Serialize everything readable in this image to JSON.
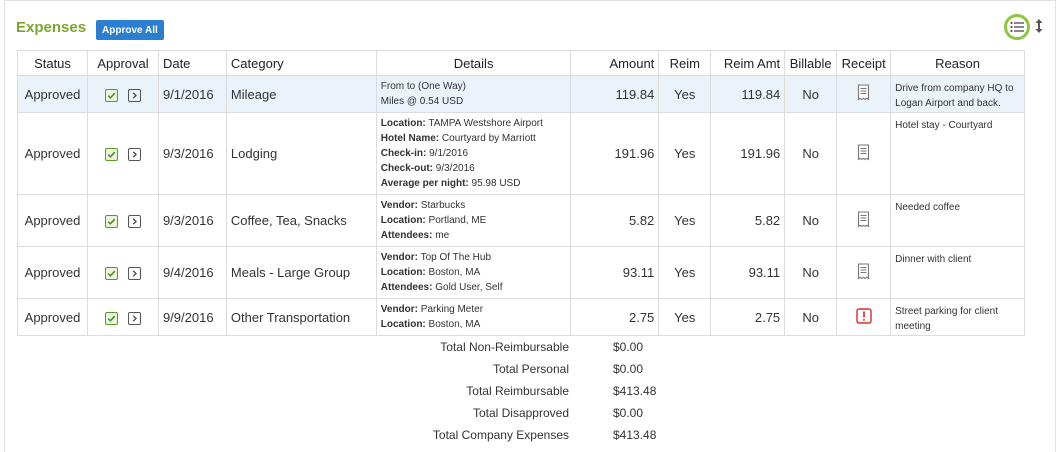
{
  "section": {
    "title": "Expenses",
    "approve_all_label": "Approve All"
  },
  "icons": {
    "view_toggle": "list-icon",
    "sort": "sort-icon",
    "approve": "check-icon",
    "details": "arrow-right-icon",
    "receipt": "receipt-icon",
    "receipt_missing": "exclamation-icon"
  },
  "colors": {
    "accent": "#7aa72c",
    "button": "#2b7fd1",
    "highlight_row": "#eaf2fa",
    "missing_receipt": "#d62c2c",
    "focus_ring": "#8cc63f"
  },
  "table": {
    "headers": [
      "Status",
      "Approval",
      "Date",
      "Category",
      "Details",
      "Amount",
      "Reim",
      "Reim Amt",
      "Billable",
      "Receipt",
      "Reason"
    ],
    "rows": [
      {
        "status": "Approved",
        "date": "9/1/2016",
        "category": "Mileage",
        "details": [
          [
            "",
            "From to (One Way)"
          ],
          [
            "",
            "Miles @ 0.54 USD"
          ]
        ],
        "amount": "119.84",
        "reim": "Yes",
        "reim_amt": "119.84",
        "billable": "No",
        "receipt": "receipt-icon",
        "reason": "Drive from company HQ to Logan Airport and back."
      },
      {
        "status": "Approved",
        "date": "9/3/2016",
        "category": "Lodging",
        "details": [
          [
            "Location:",
            "TAMPA Westshore Airport"
          ],
          [
            "Hotel Name:",
            "Courtyard by Marriott"
          ],
          [
            "Check-in:",
            "9/1/2016"
          ],
          [
            "Check-out:",
            "9/3/2016"
          ],
          [
            "Average per night:",
            "95.98 USD"
          ]
        ],
        "amount": "191.96",
        "reim": "Yes",
        "reim_amt": "191.96",
        "billable": "No",
        "receipt": "receipt-icon",
        "reason": "Hotel stay - Courtyard"
      },
      {
        "status": "Approved",
        "date": "9/3/2016",
        "category": "Coffee, Tea, Snacks",
        "details": [
          [
            "Vendor:",
            "Starbucks"
          ],
          [
            "Location:",
            "Portland, ME"
          ],
          [
            "Attendees:",
            "me"
          ]
        ],
        "amount": "5.82",
        "reim": "Yes",
        "reim_amt": "5.82",
        "billable": "No",
        "receipt": "receipt-icon",
        "reason": "Needed coffee"
      },
      {
        "status": "Approved",
        "date": "9/4/2016",
        "category": "Meals - Large Group",
        "details": [
          [
            "Vendor:",
            "Top Of The Hub"
          ],
          [
            "Location:",
            "Boston, MA"
          ],
          [
            "Attendees:",
            "Gold User, Self"
          ]
        ],
        "amount": "93.11",
        "reim": "Yes",
        "reim_amt": "93.11",
        "billable": "No",
        "receipt": "receipt-icon",
        "reason": "Dinner with client"
      },
      {
        "status": "Approved",
        "date": "9/9/2016",
        "category": "Other Transportation",
        "details": [
          [
            "Vendor:",
            "Parking Meter"
          ],
          [
            "Location:",
            "Boston, MA"
          ]
        ],
        "amount": "2.75",
        "reim": "Yes",
        "reim_amt": "2.75",
        "billable": "No",
        "receipt": "exclamation-icon",
        "reason": "Street parking for client meeting"
      }
    ]
  },
  "totals": [
    {
      "label": "Total Non-Reimbursable",
      "value": "$0.00"
    },
    {
      "label": "Total Personal",
      "value": "$0.00"
    },
    {
      "label": "Total Reimbursable",
      "value": "$413.48"
    },
    {
      "label": "Total Disapproved",
      "value": "$0.00"
    },
    {
      "label": "Total Company Expenses",
      "value": "$413.48"
    }
  ]
}
